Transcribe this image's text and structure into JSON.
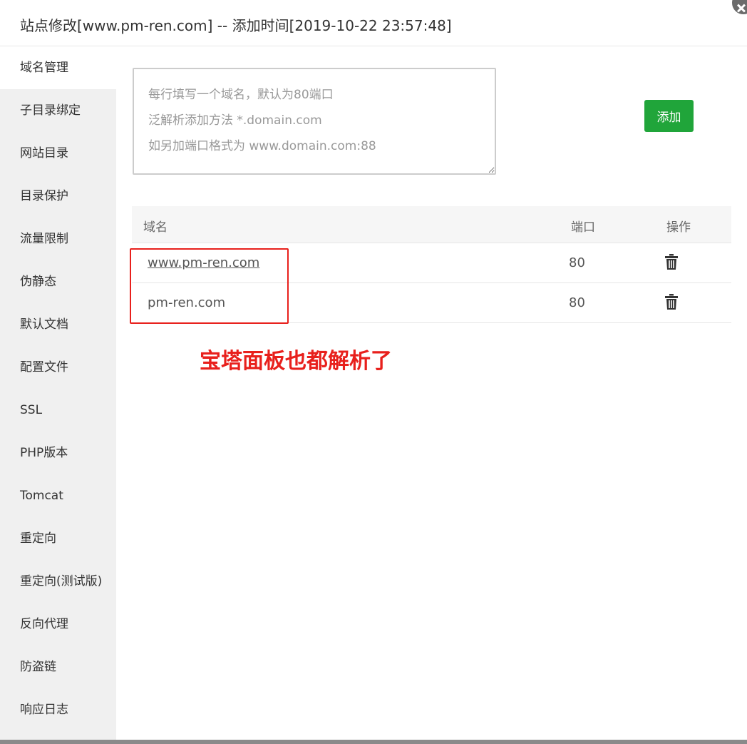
{
  "dialog": {
    "title": "站点修改[www.pm-ren.com] -- 添加时间[2019-10-22 23:57:48]"
  },
  "sidebar": {
    "items": [
      {
        "label": "域名管理"
      },
      {
        "label": "子目录绑定"
      },
      {
        "label": "网站目录"
      },
      {
        "label": "目录保护"
      },
      {
        "label": "流量限制"
      },
      {
        "label": "伪静态"
      },
      {
        "label": "默认文档"
      },
      {
        "label": "配置文件"
      },
      {
        "label": "SSL"
      },
      {
        "label": "PHP版本"
      },
      {
        "label": "Tomcat"
      },
      {
        "label": "重定向"
      },
      {
        "label": "重定向(测试版)"
      },
      {
        "label": "反向代理"
      },
      {
        "label": "防盗链"
      },
      {
        "label": "响应日志"
      }
    ],
    "active": "域名管理"
  },
  "domain_form": {
    "placeholder": "每行填写一个域名，默认为80端口\n泛解析添加方法 *.domain.com\n如另加端口格式为 www.domain.com:88",
    "value": "",
    "add_label": "添加"
  },
  "domain_table": {
    "headers": {
      "domain": "域名",
      "port": "端口",
      "action": "操作"
    },
    "rows": [
      {
        "domain": "www.pm-ren.com",
        "port": "80",
        "action_icon": "trash-icon"
      },
      {
        "domain": "pm-ren.com",
        "port": "80",
        "action_icon": "trash-icon"
      }
    ]
  },
  "annotation": {
    "text": "宝塔面板也都解析了",
    "color": "#e8201c"
  },
  "colors": {
    "primary_button": "#20a53a",
    "sidebar_bg": "#f0f0f0",
    "annotation_red": "#e8201c"
  }
}
